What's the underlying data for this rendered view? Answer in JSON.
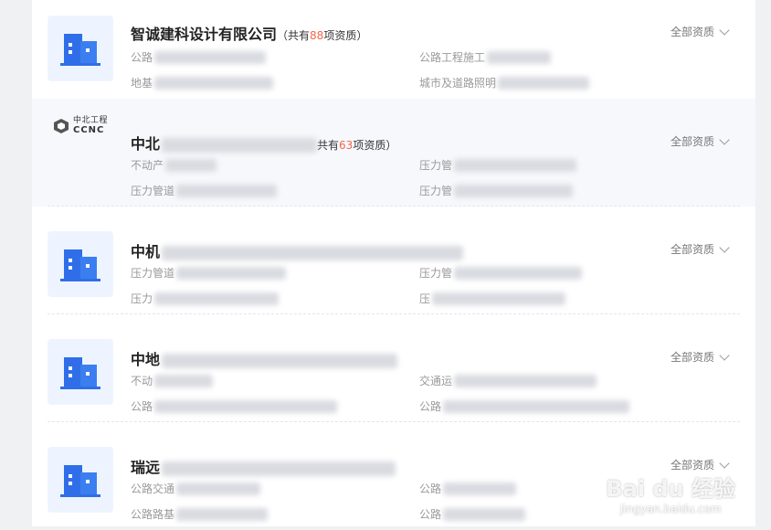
{
  "colors": {
    "accent": "#f2684d",
    "icon_blue": "#2f6ee8",
    "highlight_bg": "#f6f8fc"
  },
  "all_label": "全部资质",
  "rows": [
    {
      "title": "智诚建科设计有限公司",
      "count_prefix": "（共有",
      "count": "88",
      "count_suffix": "项资质）",
      "logo": "building-icon",
      "q1": "公路",
      "q2": "公路工程施工",
      "q3": "地基",
      "q4": "城市及道路照明"
    },
    {
      "title": "中北",
      "count_prefix": "共有",
      "count": "63",
      "count_suffix": "项资质）",
      "logo": "ccnc-logo",
      "logo_cn": "中北工程",
      "logo_en": "CCNC",
      "q1": "不动产",
      "q2": "压力管",
      "q3": "压力管道",
      "q4": "压力管"
    },
    {
      "title": "中机",
      "logo": "building-icon",
      "q1": "压力管道",
      "q2": "压力管",
      "q3": "压力",
      "q4": "压"
    },
    {
      "title": "中地",
      "logo": "building-icon",
      "q1": "不动",
      "q2": "交通运",
      "q3": "公路",
      "q4": "公路"
    },
    {
      "title": "瑞远",
      "logo": "building-icon",
      "q1": "公路交通",
      "q2": "公路",
      "q3": "公路路基",
      "q4": "公路"
    }
  ],
  "watermark": {
    "logo": "Bai du 经验",
    "url": "jingyan.baidu.com"
  }
}
